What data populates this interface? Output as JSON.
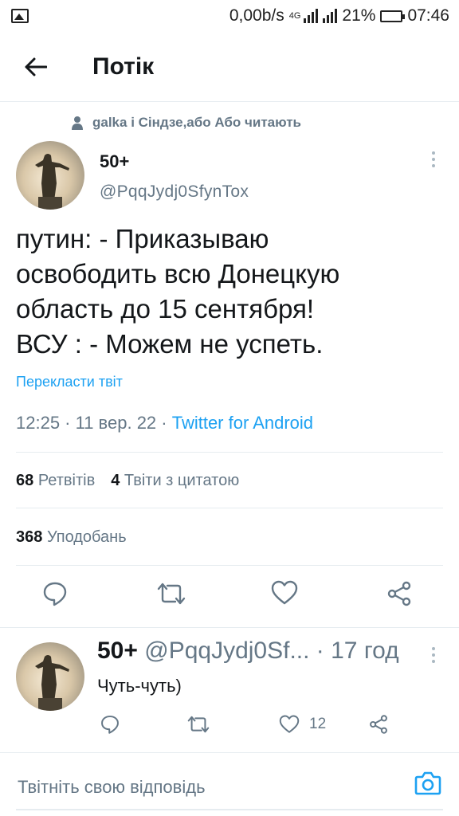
{
  "status_bar": {
    "speed": "0,00b/s",
    "network": "4G",
    "battery": "21%",
    "time": "07:46"
  },
  "header": {
    "title": "Потік"
  },
  "context": {
    "text": "galka і Сіндзе,або Або читають"
  },
  "tweet": {
    "name": "50+",
    "handle": "@PqqJydj0SfynTox",
    "text_lines": [
      "путин: - Приказываю",
      "освободить всю Донецкую",
      "область до 15 сентября!",
      "ВСУ : - Можем не успеть."
    ],
    "translate": "Перекласти твіт",
    "meta_time": "12:25 · 11 вер. 22 · ",
    "meta_source": "Twitter for Android",
    "retweets_count": "68",
    "retweets_label": "Ретвітів",
    "quotes_count": "4",
    "quotes_label": "Твіти з цитатою",
    "likes_count": "368",
    "likes_label": "Уподобань"
  },
  "reply": {
    "name": "50+",
    "handle": "@PqqJydj0Sf...",
    "time": "· 17 год",
    "text": "Чуть-чуть)",
    "likes": "12"
  },
  "compose": {
    "placeholder": "Твітніть свою відповідь"
  },
  "colors": {
    "accent": "#1da1f2",
    "secondary": "#657786",
    "divider": "#e6ecf0"
  }
}
